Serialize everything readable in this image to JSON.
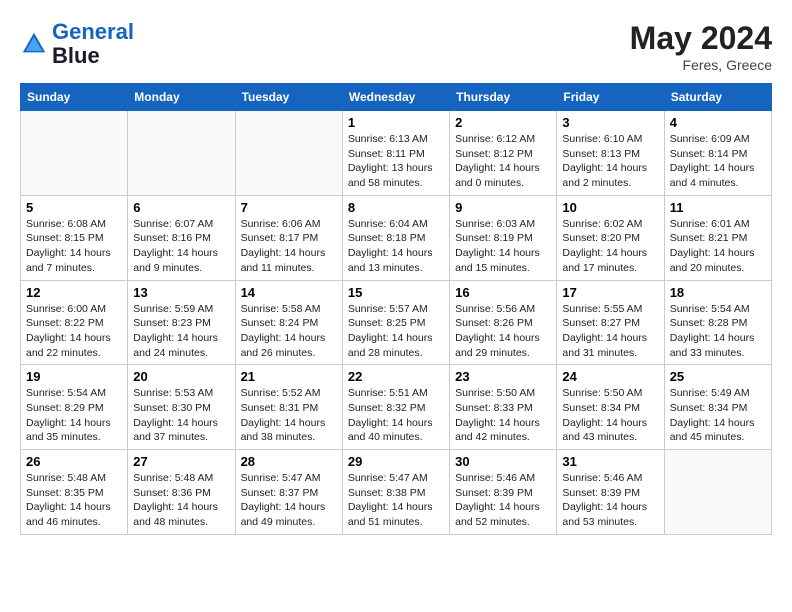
{
  "header": {
    "logo_line1": "General",
    "logo_line2": "Blue",
    "month": "May 2024",
    "location": "Feres, Greece"
  },
  "weekdays": [
    "Sunday",
    "Monday",
    "Tuesday",
    "Wednesday",
    "Thursday",
    "Friday",
    "Saturday"
  ],
  "weeks": [
    [
      {
        "day": "",
        "info": ""
      },
      {
        "day": "",
        "info": ""
      },
      {
        "day": "",
        "info": ""
      },
      {
        "day": "1",
        "info": "Sunrise: 6:13 AM\nSunset: 8:11 PM\nDaylight: 13 hours and 58 minutes."
      },
      {
        "day": "2",
        "info": "Sunrise: 6:12 AM\nSunset: 8:12 PM\nDaylight: 14 hours and 0 minutes."
      },
      {
        "day": "3",
        "info": "Sunrise: 6:10 AM\nSunset: 8:13 PM\nDaylight: 14 hours and 2 minutes."
      },
      {
        "day": "4",
        "info": "Sunrise: 6:09 AM\nSunset: 8:14 PM\nDaylight: 14 hours and 4 minutes."
      }
    ],
    [
      {
        "day": "5",
        "info": "Sunrise: 6:08 AM\nSunset: 8:15 PM\nDaylight: 14 hours and 7 minutes."
      },
      {
        "day": "6",
        "info": "Sunrise: 6:07 AM\nSunset: 8:16 PM\nDaylight: 14 hours and 9 minutes."
      },
      {
        "day": "7",
        "info": "Sunrise: 6:06 AM\nSunset: 8:17 PM\nDaylight: 14 hours and 11 minutes."
      },
      {
        "day": "8",
        "info": "Sunrise: 6:04 AM\nSunset: 8:18 PM\nDaylight: 14 hours and 13 minutes."
      },
      {
        "day": "9",
        "info": "Sunrise: 6:03 AM\nSunset: 8:19 PM\nDaylight: 14 hours and 15 minutes."
      },
      {
        "day": "10",
        "info": "Sunrise: 6:02 AM\nSunset: 8:20 PM\nDaylight: 14 hours and 17 minutes."
      },
      {
        "day": "11",
        "info": "Sunrise: 6:01 AM\nSunset: 8:21 PM\nDaylight: 14 hours and 20 minutes."
      }
    ],
    [
      {
        "day": "12",
        "info": "Sunrise: 6:00 AM\nSunset: 8:22 PM\nDaylight: 14 hours and 22 minutes."
      },
      {
        "day": "13",
        "info": "Sunrise: 5:59 AM\nSunset: 8:23 PM\nDaylight: 14 hours and 24 minutes."
      },
      {
        "day": "14",
        "info": "Sunrise: 5:58 AM\nSunset: 8:24 PM\nDaylight: 14 hours and 26 minutes."
      },
      {
        "day": "15",
        "info": "Sunrise: 5:57 AM\nSunset: 8:25 PM\nDaylight: 14 hours and 28 minutes."
      },
      {
        "day": "16",
        "info": "Sunrise: 5:56 AM\nSunset: 8:26 PM\nDaylight: 14 hours and 29 minutes."
      },
      {
        "day": "17",
        "info": "Sunrise: 5:55 AM\nSunset: 8:27 PM\nDaylight: 14 hours and 31 minutes."
      },
      {
        "day": "18",
        "info": "Sunrise: 5:54 AM\nSunset: 8:28 PM\nDaylight: 14 hours and 33 minutes."
      }
    ],
    [
      {
        "day": "19",
        "info": "Sunrise: 5:54 AM\nSunset: 8:29 PM\nDaylight: 14 hours and 35 minutes."
      },
      {
        "day": "20",
        "info": "Sunrise: 5:53 AM\nSunset: 8:30 PM\nDaylight: 14 hours and 37 minutes."
      },
      {
        "day": "21",
        "info": "Sunrise: 5:52 AM\nSunset: 8:31 PM\nDaylight: 14 hours and 38 minutes."
      },
      {
        "day": "22",
        "info": "Sunrise: 5:51 AM\nSunset: 8:32 PM\nDaylight: 14 hours and 40 minutes."
      },
      {
        "day": "23",
        "info": "Sunrise: 5:50 AM\nSunset: 8:33 PM\nDaylight: 14 hours and 42 minutes."
      },
      {
        "day": "24",
        "info": "Sunrise: 5:50 AM\nSunset: 8:34 PM\nDaylight: 14 hours and 43 minutes."
      },
      {
        "day": "25",
        "info": "Sunrise: 5:49 AM\nSunset: 8:34 PM\nDaylight: 14 hours and 45 minutes."
      }
    ],
    [
      {
        "day": "26",
        "info": "Sunrise: 5:48 AM\nSunset: 8:35 PM\nDaylight: 14 hours and 46 minutes."
      },
      {
        "day": "27",
        "info": "Sunrise: 5:48 AM\nSunset: 8:36 PM\nDaylight: 14 hours and 48 minutes."
      },
      {
        "day": "28",
        "info": "Sunrise: 5:47 AM\nSunset: 8:37 PM\nDaylight: 14 hours and 49 minutes."
      },
      {
        "day": "29",
        "info": "Sunrise: 5:47 AM\nSunset: 8:38 PM\nDaylight: 14 hours and 51 minutes."
      },
      {
        "day": "30",
        "info": "Sunrise: 5:46 AM\nSunset: 8:39 PM\nDaylight: 14 hours and 52 minutes."
      },
      {
        "day": "31",
        "info": "Sunrise: 5:46 AM\nSunset: 8:39 PM\nDaylight: 14 hours and 53 minutes."
      },
      {
        "day": "",
        "info": ""
      }
    ]
  ]
}
